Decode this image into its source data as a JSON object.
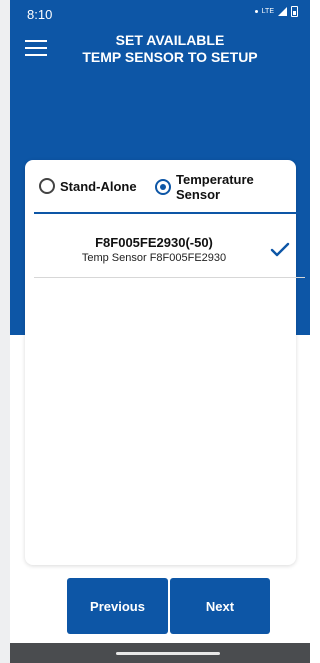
{
  "status_bar": {
    "time": "8:10",
    "network": "LTE"
  },
  "header": {
    "title_line1": "SET AVAILABLE",
    "title_line2": "TEMP SENSOR TO SETUP"
  },
  "mode_selector": {
    "options": [
      {
        "label": "Stand-Alone",
        "selected": false
      },
      {
        "label_line1": "Temperature",
        "label_line2": "Sensor",
        "selected": true
      }
    ]
  },
  "sensors": [
    {
      "name": "F8F005FE2930(-50)",
      "subtitle": "Temp Sensor F8F005FE2930",
      "selected": true
    }
  ],
  "footer": {
    "previous_label": "Previous",
    "next_label": "Next"
  },
  "colors": {
    "primary": "#0d56a6",
    "background": "#ffffff"
  }
}
